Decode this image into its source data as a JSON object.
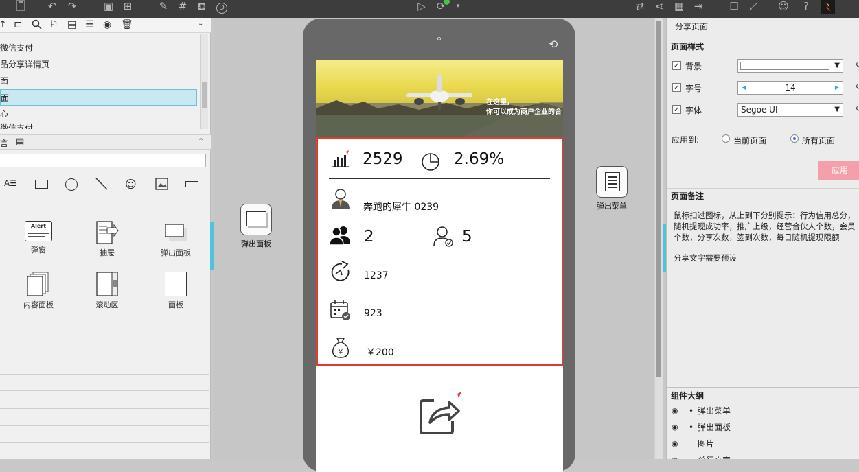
{
  "toolbar": {
    "icons": [
      "save-icon",
      "undo-icon",
      "redo-icon",
      "page-icon",
      "components-icon",
      "brush-icon",
      "grid-icon",
      "paint-bucket-icon",
      "d-badge-icon",
      "play-icon",
      "sync-icon",
      "dropdown-icon",
      "align-icon",
      "share-icon",
      "qr-icon",
      "export-icon",
      "window-icon",
      "fullscreen-icon",
      "user-icon",
      "help-icon",
      "app-logo-icon"
    ],
    "d_label": "D"
  },
  "pages": {
    "items": [
      {
        "label": "微信支付",
        "selected": false
      },
      {
        "label": "品分享详情页",
        "selected": false
      },
      {
        "label": "面",
        "selected": false
      },
      {
        "label": "面",
        "selected": true
      },
      {
        "label": "心",
        "selected": false
      },
      {
        "label": "微信支付",
        "selected": false
      }
    ]
  },
  "library": {
    "header_label": "言",
    "widgets": [
      {
        "label": "弹窗"
      },
      {
        "label": "抽屉"
      },
      {
        "label": "弹出面板"
      },
      {
        "label": "内容面板"
      },
      {
        "label": "滚动区"
      },
      {
        "label": "面板"
      }
    ],
    "alert_text": "Alert"
  },
  "canvas": {
    "popup_panel_label": "弹出面板",
    "popup_menu_label": "弹出菜单",
    "banner_text_1": "在这里，",
    "banner_text_2": "你可以成为商户企业的合",
    "stats": {
      "credit_total": "2529",
      "success_rate": "2.69%",
      "user_name": "奔跑的犀牛 0239",
      "superior_count": "2",
      "partner_count": "5",
      "share_count": "1237",
      "checkin_count": "923",
      "withdraw_limit": "￥200"
    }
  },
  "right_panel": {
    "page_title": "分享页面",
    "style_section": "页面样式",
    "bg_label": "背景",
    "font_size_label": "字号",
    "font_size_value": "14",
    "font_family_label": "字体",
    "font_family_value": "Segoe UI",
    "apply_to_label": "应用到:",
    "current_page_label": "当前页面",
    "all_pages_label": "所有页面",
    "apply_button": "应用",
    "notes_section": "页面备注",
    "notes_text_1": "鼠标扫过图标，从上到下分别提示：行为信用总分，",
    "notes_text_2": "随机提现成功率，推广上级，经营合伙人个数，会员",
    "notes_text_3": "个数，分享次数，签到次数，每日随机提现限额",
    "notes_text_4": "分享文字需要预设",
    "outline_section": "组件大纲",
    "outline_items": [
      {
        "label": "弹出菜单"
      },
      {
        "label": "弹出面板"
      },
      {
        "label": "图片"
      },
      {
        "label": "单行文字"
      }
    ]
  }
}
